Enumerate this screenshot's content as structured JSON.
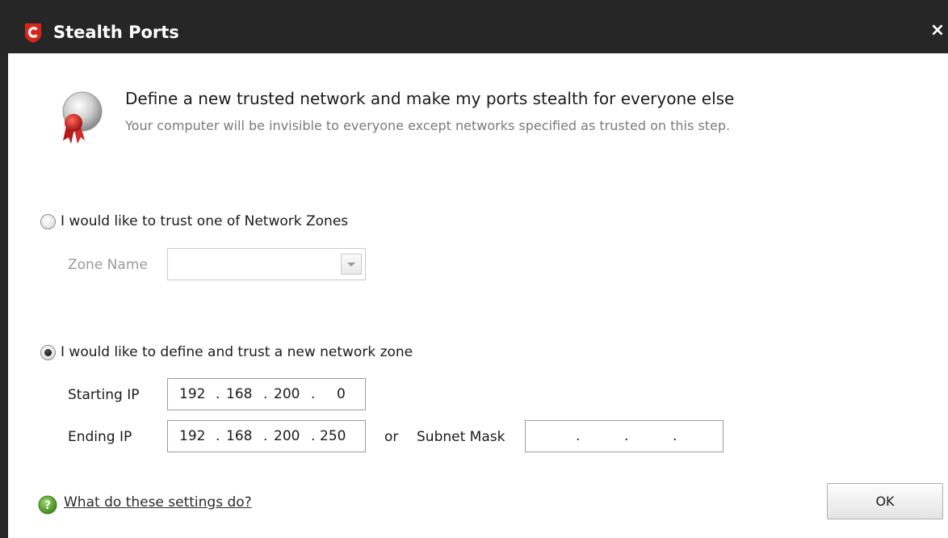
{
  "window": {
    "title": "Stealth Ports",
    "close_glyph": "×"
  },
  "header": {
    "heading": "Define a new trusted network and make my ports stealth for everyone else",
    "subheading": "Your computer will be invisible to everyone except networks specified as trusted on this step."
  },
  "option_zone": {
    "label": "I would like to trust one of Network Zones",
    "selected": false,
    "zone_name_label": "Zone Name",
    "zone_name_value": ""
  },
  "option_new": {
    "label": "I would like to define and trust a new network zone",
    "selected": true,
    "starting_ip_label": "Starting IP",
    "starting_ip": [
      "192",
      "168",
      "200",
      "0"
    ],
    "ending_ip_label": "Ending IP",
    "ending_ip": [
      "192",
      "168",
      "200",
      "250"
    ],
    "or_label": "or",
    "subnet_mask_label": "Subnet Mask",
    "subnet_mask": [
      "",
      "",
      "",
      ""
    ]
  },
  "footer": {
    "help_link": "What do these settings do?",
    "ok_label": "OK"
  },
  "icons": {
    "app": "comodo-logo-icon",
    "header": "award-badge-icon",
    "help": "help-icon",
    "close": "close-icon"
  },
  "colors": {
    "titlebar": "#262626",
    "logo_red": "#d9261c",
    "help_green": "#5aa02c"
  }
}
